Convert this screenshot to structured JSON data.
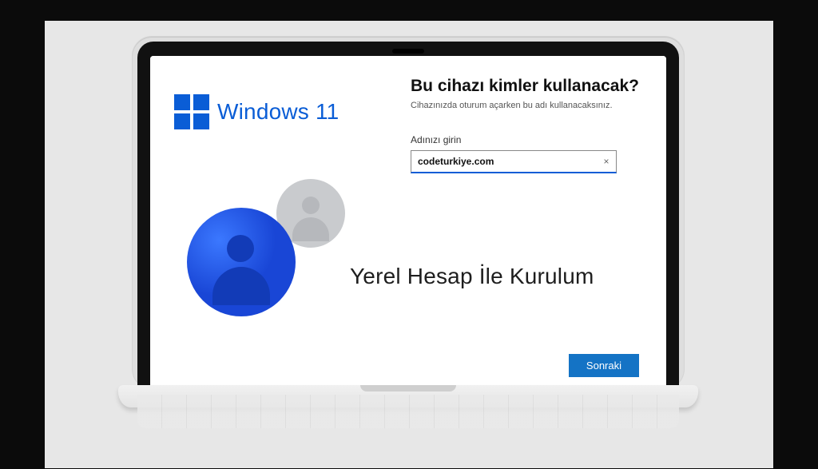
{
  "brand": {
    "product_name": "Windows 11"
  },
  "setup": {
    "heading": "Bu cihazı kimler kullanacak?",
    "subtitle": "Cihazınızda oturum açarken bu adı kullanacaksınız.",
    "name_label": "Adınızı girin",
    "name_value": "codeturkiye.com",
    "clear_glyph": "×",
    "next_label": "Sonraki"
  },
  "caption": {
    "text": "Yerel Hesap İle Kurulum"
  },
  "colors": {
    "accent_blue": "#0a5dd6",
    "button_blue": "#1473c5"
  }
}
